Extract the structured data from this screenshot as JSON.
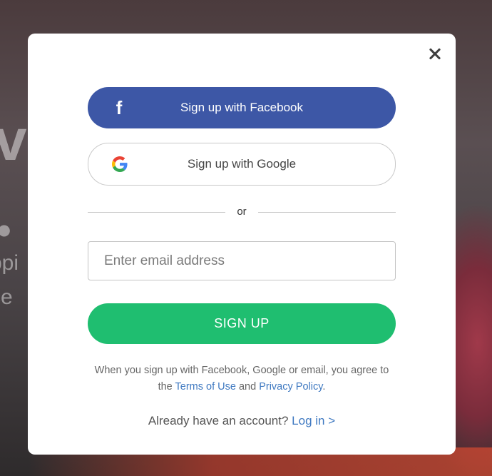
{
  "background": {
    "heading_fragment": "ve",
    "dot": "•",
    "line1": "ppi",
    "line2": "ce"
  },
  "modal": {
    "close_icon": "close-icon",
    "facebook_button": {
      "label": "Sign up with Facebook",
      "icon": "facebook-icon",
      "color": "#3d57a6"
    },
    "google_button": {
      "label": "Sign up with Google",
      "icon": "google-icon"
    },
    "divider_text": "or",
    "email": {
      "placeholder": "Enter email address",
      "value": ""
    },
    "signup_button": {
      "label": "SIGN UP",
      "color": "#1fbe70"
    },
    "terms": {
      "prefix": "When you sign up with Facebook, Google or email, you agree to the ",
      "terms_link": "Terms of Use",
      "middle": " and ",
      "privacy_link": "Privacy Policy",
      "suffix": "."
    },
    "login": {
      "prompt": "Already have an account?",
      "link": "Log in >"
    },
    "link_color": "#3f79c1"
  }
}
